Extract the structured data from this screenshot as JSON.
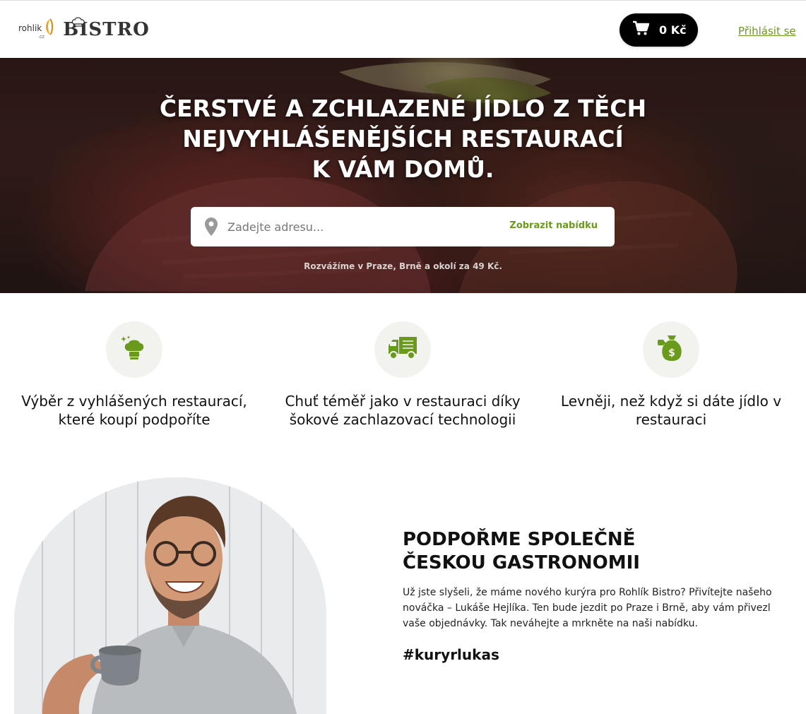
{
  "header": {
    "logo_rohlik": "rohlik",
    "logo_cz": ".cz",
    "logo_bistro": "BISTRO",
    "cart_amount": "0 Kč",
    "login_label": "Přihlásit se"
  },
  "hero": {
    "title_line1": "ČERSTVÉ A ZCHLAZENÉ JÍDLO Z TĚCH",
    "title_line2": "NEJVYHLÁŠENĚJŠÍCH RESTAURACÍ",
    "title_line3": "K VÁM DOMŮ.",
    "search_placeholder": "Zadejte adresu...",
    "search_button": "Zobrazit nabídku",
    "delivery_note": "Rozvážíme v Praze, Brně a okolí za 49 Kč."
  },
  "features": [
    {
      "icon": "chef-hat-icon",
      "line1": "Výběr z vyhlášených restaurací,",
      "line2": "které koupí podpoříte"
    },
    {
      "icon": "delivery-truck-icon",
      "line1": "Chuť téměř jako v restauraci díky",
      "line2": "šokové zachlazovací technologii"
    },
    {
      "icon": "money-bag-icon",
      "line1": "Levněji, než když si dáte jídlo v",
      "line2": "restauraci"
    }
  ],
  "promo": {
    "heading_line1": "PODPOŘME SPOLEČNĚ",
    "heading_line2": "ČESKOU GASTRONOMII",
    "text_line1": "Už jste slyšeli, že máme nového kurýra pro Rohlík Bistro? Přivítejte našeho",
    "text_line2": "nováčka – Lukáše Hejlíka. Ten bude jezdit po Praze i Brně, aby vám přivezl",
    "text_line3": "vaše objednávky. Tak neváhejte a mrkněte na naši nabídku.",
    "hashtag": "#kuryrlukas"
  },
  "colors": {
    "accent_green": "#6a9a1b",
    "cart_bg": "#000000",
    "icon_circle_bg": "#f2f2ef"
  }
}
